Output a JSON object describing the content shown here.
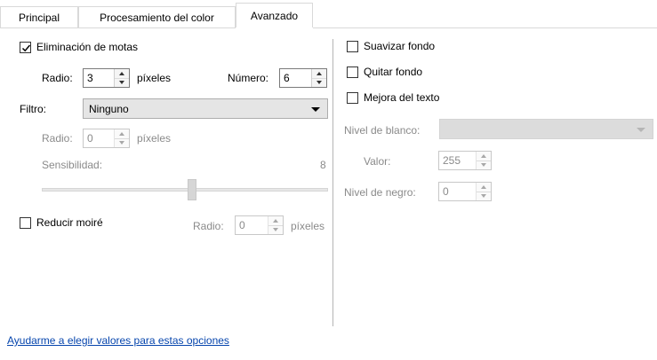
{
  "tabs": [
    {
      "label": "Principal"
    },
    {
      "label": "Procesamiento del color"
    },
    {
      "label": "Avanzado"
    }
  ],
  "left": {
    "despeckle": {
      "label": "Eliminación de motas",
      "checked": true
    },
    "radio_label": "Radio:",
    "radio_value": "3",
    "pixels_label": "píxeles",
    "number_label": "Número:",
    "number_value": "6",
    "filter_label": "Filtro:",
    "filter_value": "Ninguno",
    "filter_radio_label": "Radio:",
    "filter_radio_value": "0",
    "filter_pixels_label": "píxeles",
    "sensitivity_label": "Sensibilidad:",
    "sensitivity_value": "8",
    "moire": {
      "label": "Reducir moiré",
      "checked": false
    },
    "moire_radio_label": "Radio:",
    "moire_radio_value": "0",
    "moire_pixels_label": "píxeles"
  },
  "right": {
    "smooth_bg": {
      "label": "Suavizar fondo",
      "checked": false
    },
    "remove_bg": {
      "label": "Quitar fondo",
      "checked": false
    },
    "text_enh": {
      "label": "Mejora del texto",
      "checked": false
    },
    "white_level_label": "Nivel de blanco:",
    "white_level_value": "",
    "value_label": "Valor:",
    "value_value": "255",
    "black_level_label": "Nivel de negro:",
    "black_level_value": "0"
  },
  "help_link": "Ayudarme a elegir valores para estas opciones"
}
